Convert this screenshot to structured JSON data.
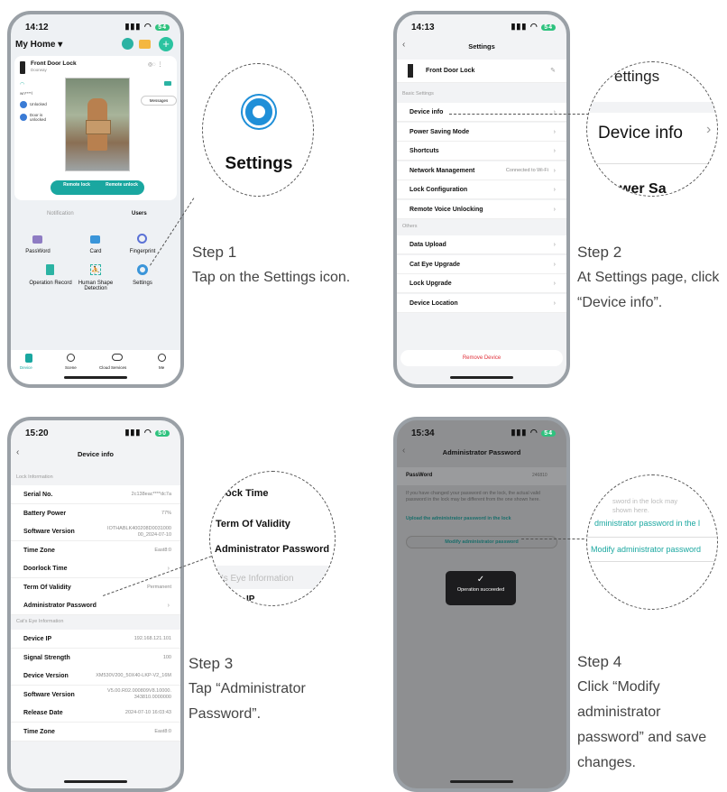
{
  "p1": {
    "time": "14:12",
    "home": "My Home ▾",
    "device": "Front Door Lock",
    "room": "Doorway",
    "wifi": "wn****l",
    "unlocked": "Unlocked",
    "door": "Door is unlocked",
    "messages": "Messages",
    "remote_lock": "Remote lock",
    "remote_unlock": "Remote unlock",
    "tab_notif": "Notification",
    "tab_users": "Users",
    "grid": [
      "PassWord",
      "Card",
      "Fingerprint",
      "Operation Record",
      "Human Shape Detection",
      "Settings"
    ],
    "nav": [
      "Device",
      "Scene",
      "Cloud Services",
      "Me"
    ]
  },
  "p2": {
    "time": "14:13",
    "title": "Settings",
    "device": "Front Door Lock",
    "sec_basic": "Basic Settings",
    "basic": [
      "Device info",
      "Power Saving Mode",
      "Shortcuts",
      "Network Management",
      "Lock Configuration",
      "Remote Voice Unlocking"
    ],
    "network_value": "Connected to Wi-Fi",
    "sec_others": "Others",
    "others": [
      "Data Upload",
      "Cat Eye Upgrade",
      "Lock Upgrade",
      "Device Location"
    ],
    "remove": "Remove Device"
  },
  "p3": {
    "time": "15:20",
    "title": "Device info",
    "sec_lock": "Lock Information",
    "lock_rows": [
      {
        "k": "Serial No.",
        "v": "2c138eac****dc7a"
      },
      {
        "k": "Battery Power",
        "v": "77%"
      },
      {
        "k": "Software Version",
        "v": "IOTHABLK400208D0031000 00_2024-07-10"
      },
      {
        "k": "Time Zone",
        "v": "East8:0"
      },
      {
        "k": "Doorlock Time",
        "v": ""
      },
      {
        "k": "Term Of Validity",
        "v": "Permanent"
      },
      {
        "k": "Administrator Password",
        "v": ""
      }
    ],
    "sec_cat": "Cat's Eye Information",
    "cat_rows": [
      {
        "k": "Device IP",
        "v": "192.168.121.101"
      },
      {
        "k": "Signal Strength",
        "v": "100"
      },
      {
        "k": "Device Version",
        "v": "XM530V200_50X40-LKP-V2_16M"
      },
      {
        "k": "Software Version",
        "v": "V5.00.R02.000809V8.10000. 343810.0000000"
      },
      {
        "k": "Release Date",
        "v": "2024-07-10 16:03:43"
      },
      {
        "k": "Time Zone",
        "v": "East8:0"
      }
    ]
  },
  "p4": {
    "time": "15:34",
    "title": "Administrator Password",
    "pw_label": "PassWord",
    "pw_value": "246810",
    "info": "If you have changed your password on the lock, the actual valid password in the lock may be different from the one shown here.",
    "upload": "Upload the administrator password in the lock",
    "modify": "Modify administrator password",
    "toast": "Operation succeeded"
  },
  "c1": {
    "text": "Settings"
  },
  "c2": {
    "top": "ettings",
    "main": "Device info",
    "bottom": "wer Sa"
  },
  "c3": {
    "top": "lock Time",
    "mid": "Term Of Validity",
    "main": "Administrator Password",
    "bottom": "t's Eye Information",
    "tail": "IP"
  },
  "c4": {
    "top": "sword in the lock may",
    "top2": "shown here.",
    "mid": "dministrator password in the l",
    "main": "Modify administrator password"
  },
  "steps": [
    {
      "h": "Step 1",
      "b": "Tap on the Settings icon."
    },
    {
      "h": "Step 2",
      "b": "At Settings page, click “Device info”."
    },
    {
      "h": "Step 3",
      "b": "Tap “Administrator Password”."
    },
    {
      "h": "Step 4",
      "b": "Click “Modify administrator password” and save changes."
    }
  ],
  "colors": {
    "accent": "#1aa7a0",
    "blue": "#1f8fd8",
    "red": "#e0303a"
  }
}
